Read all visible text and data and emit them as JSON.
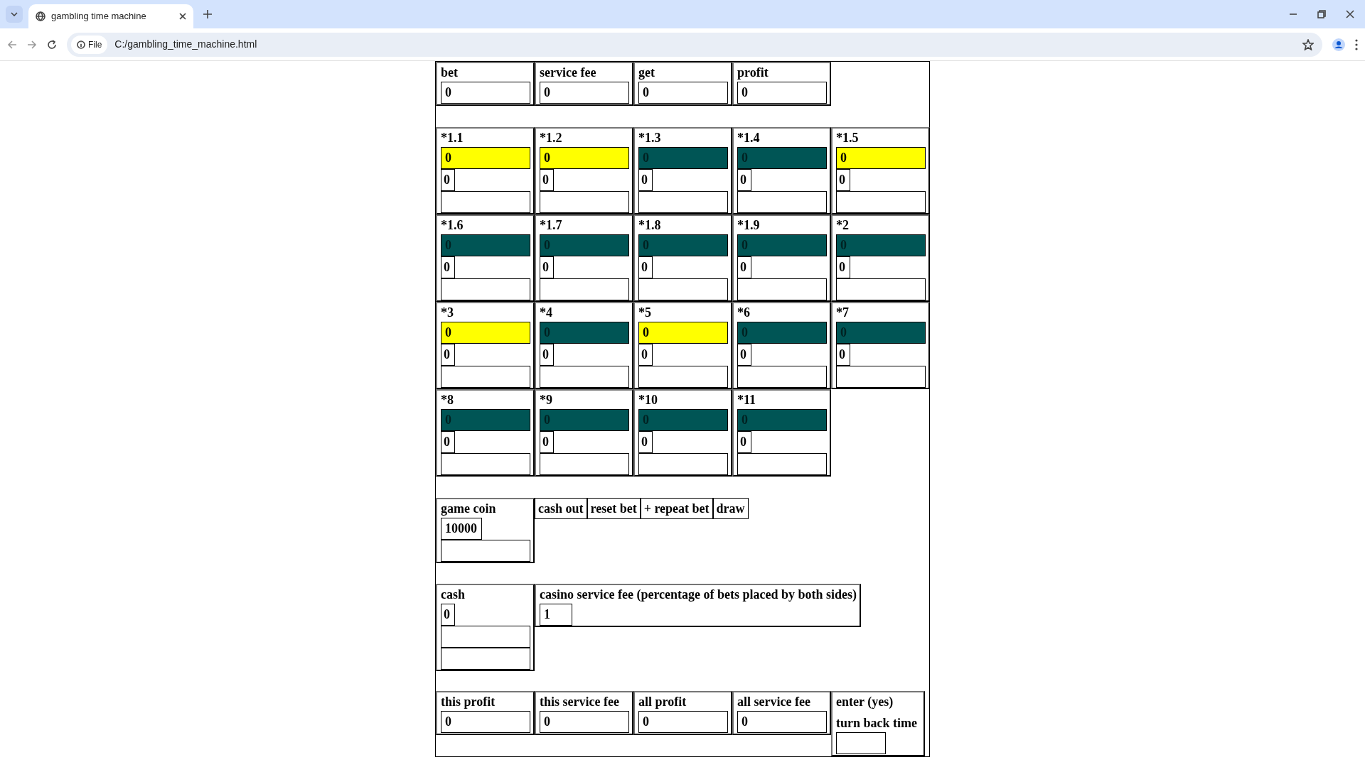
{
  "browser": {
    "tab_title": "gambling time machine",
    "site_chip": "File",
    "address": "C:/gambling_time_machine.html"
  },
  "summary": [
    {
      "label": "bet",
      "value": "0"
    },
    {
      "label": "service fee",
      "value": "0"
    },
    {
      "label": "get",
      "value": "0"
    },
    {
      "label": "profit",
      "value": "0"
    }
  ],
  "multipliers": [
    {
      "label": "*1.1",
      "value": "0",
      "highlighted": true,
      "count": "0"
    },
    {
      "label": "*1.2",
      "value": "0",
      "highlighted": true,
      "count": "0"
    },
    {
      "label": "*1.3",
      "value": "0",
      "highlighted": false,
      "count": "0"
    },
    {
      "label": "*1.4",
      "value": "0",
      "highlighted": false,
      "count": "0"
    },
    {
      "label": "*1.5",
      "value": "0",
      "highlighted": true,
      "count": "0"
    },
    {
      "label": "*1.6",
      "value": "0",
      "highlighted": false,
      "count": "0"
    },
    {
      "label": "*1.7",
      "value": "0",
      "highlighted": false,
      "count": "0"
    },
    {
      "label": "*1.8",
      "value": "0",
      "highlighted": false,
      "count": "0"
    },
    {
      "label": "*1.9",
      "value": "0",
      "highlighted": false,
      "count": "0"
    },
    {
      "label": "*2",
      "value": "0",
      "highlighted": false,
      "count": "0"
    },
    {
      "label": "*3",
      "value": "0",
      "highlighted": true,
      "count": "0"
    },
    {
      "label": "*4",
      "value": "0",
      "highlighted": false,
      "count": "0"
    },
    {
      "label": "*5",
      "value": "0",
      "highlighted": true,
      "count": "0"
    },
    {
      "label": "*6",
      "value": "0",
      "highlighted": false,
      "count": "0"
    },
    {
      "label": "*7",
      "value": "0",
      "highlighted": false,
      "count": "0"
    },
    {
      "label": "*8",
      "value": "0",
      "highlighted": false,
      "count": "0"
    },
    {
      "label": "*9",
      "value": "0",
      "highlighted": false,
      "count": "0"
    },
    {
      "label": "*10",
      "value": "0",
      "highlighted": false,
      "count": "0"
    },
    {
      "label": "*11",
      "value": "0",
      "highlighted": false,
      "count": "0"
    }
  ],
  "game_coin": {
    "label": "game coin",
    "value": "10000"
  },
  "buttons": [
    "cash out",
    "reset bet",
    "+ repeat bet",
    "draw"
  ],
  "cash": {
    "label": "cash",
    "value": "0"
  },
  "casino_fee": {
    "label": "casino service fee (percentage of bets placed by both sides)",
    "value": "1"
  },
  "totals": [
    {
      "label": "this profit",
      "value": "0"
    },
    {
      "label": "this service fee",
      "value": "0"
    },
    {
      "label": "all profit",
      "value": "0"
    },
    {
      "label": "all service fee",
      "value": "0"
    }
  ],
  "turn_back": {
    "label": "enter (yes)",
    "sublabel": "turn back time"
  }
}
